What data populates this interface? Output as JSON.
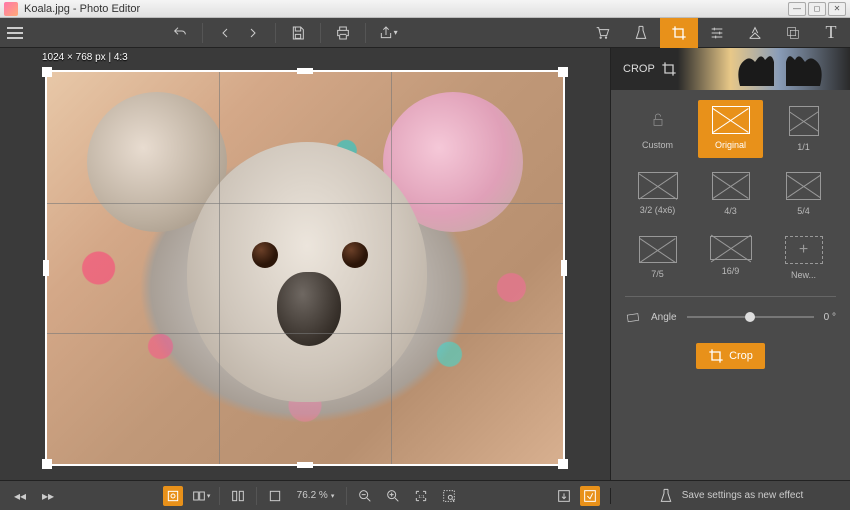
{
  "window": {
    "title": "Koala.jpg - Photo Editor"
  },
  "canvas": {
    "dim_label": "1024 × 768 px | 4:3",
    "zoom": "76.2 %"
  },
  "crop_panel": {
    "title": "CROP",
    "options": [
      {
        "label": "Custom"
      },
      {
        "label": "Original"
      },
      {
        "label": "1/1"
      },
      {
        "label": "3/2 (4x6)"
      },
      {
        "label": "4/3"
      },
      {
        "label": "5/4"
      },
      {
        "label": "7/5"
      },
      {
        "label": "16/9"
      },
      {
        "label": "New..."
      }
    ],
    "angle_label": "Angle",
    "angle_value": "0 °",
    "crop_button": "Crop"
  },
  "bottombar": {
    "save_effect": "Save settings as new effect"
  }
}
